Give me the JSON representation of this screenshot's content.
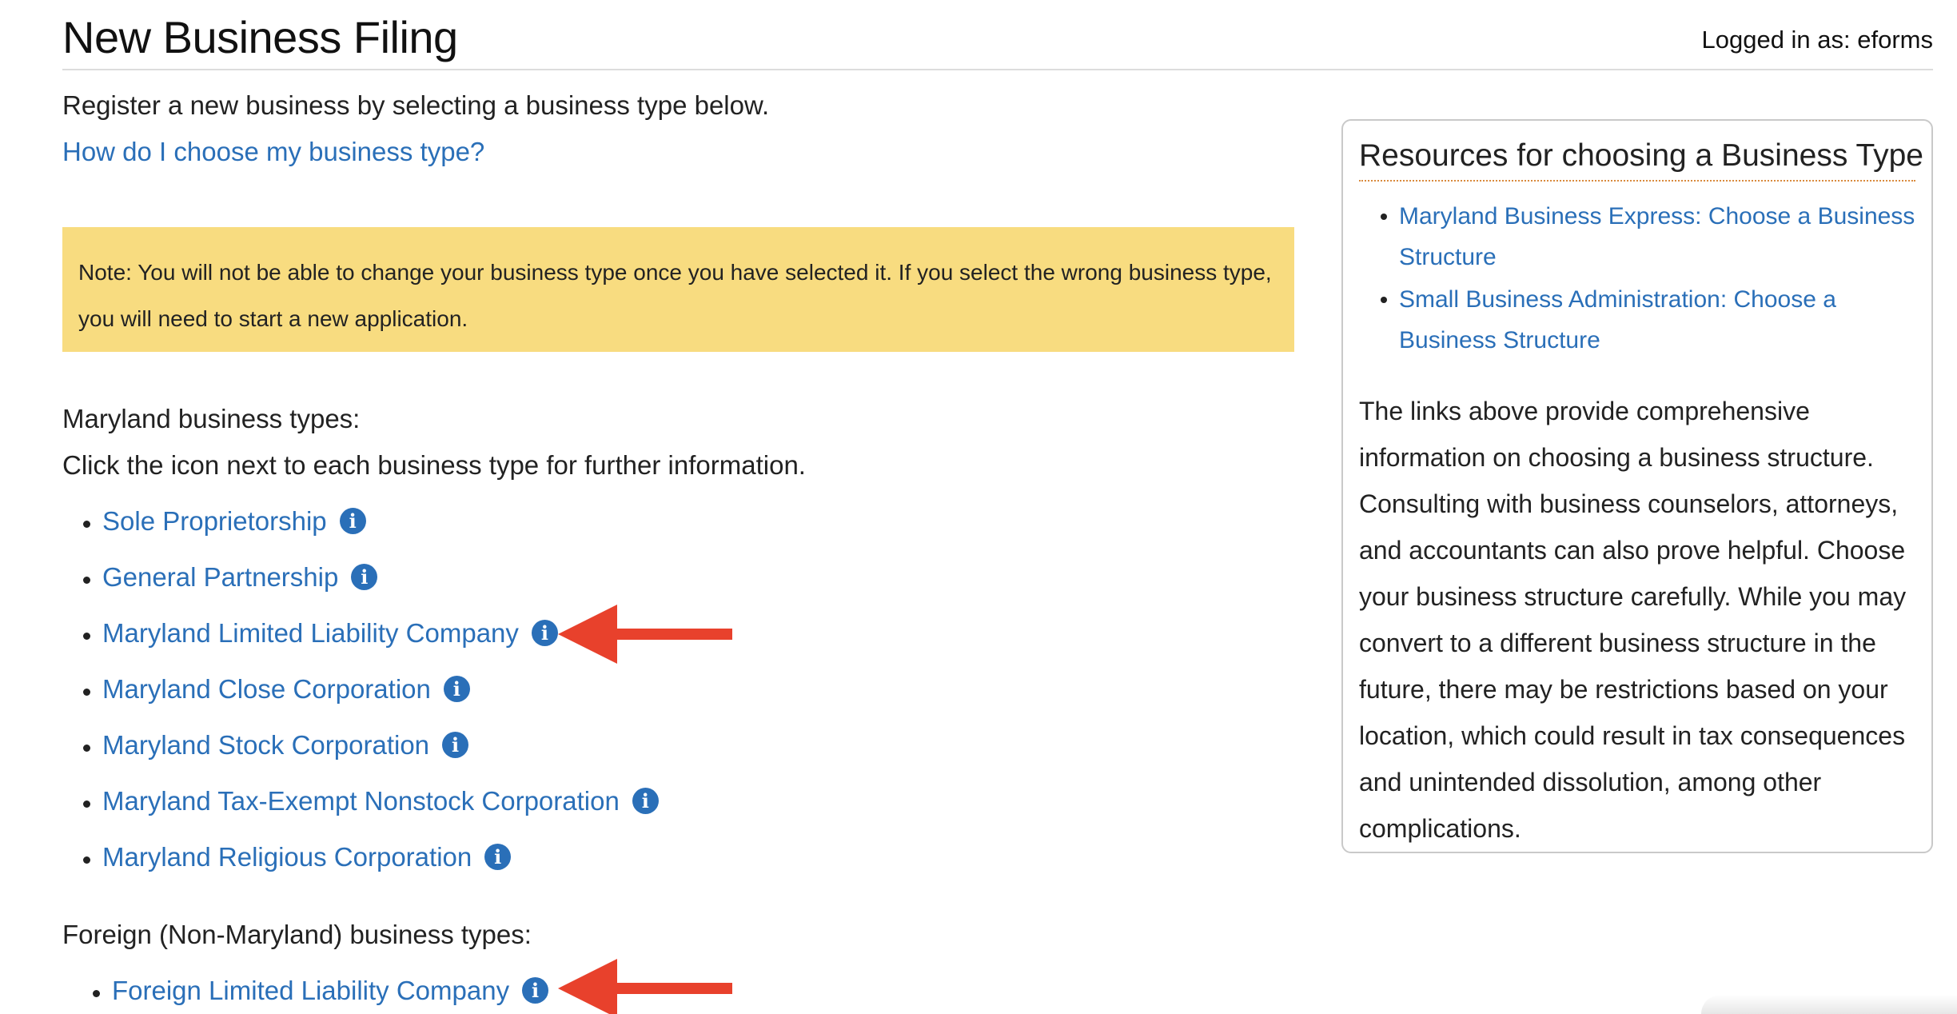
{
  "header": {
    "title": "New Business Filing",
    "logged_in": "Logged in as: eforms"
  },
  "main": {
    "intro": "Register a new business by selecting a business type below.",
    "help_link": "How do I choose my business type?",
    "note": "Note: You will not be able to change your business type once you have selected it. If you select the wrong business type, you will need to start a new application.",
    "maryland_label": "Maryland business types:",
    "maryland_instructions": "Click the icon next to each business type for further information.",
    "maryland_types": [
      {
        "label": "Sole Proprietorship",
        "icon": "info-icon"
      },
      {
        "label": "General Partnership",
        "icon": "info-icon"
      },
      {
        "label": "Maryland Limited Liability Company",
        "icon": "info-icon"
      },
      {
        "label": "Maryland Close Corporation",
        "icon": "info-icon"
      },
      {
        "label": "Maryland Stock Corporation",
        "icon": "info-icon"
      },
      {
        "label": "Maryland Tax-Exempt Nonstock Corporation",
        "icon": "info-icon"
      },
      {
        "label": "Maryland Religious Corporation",
        "icon": "info-icon"
      }
    ],
    "foreign_label": "Foreign (Non-Maryland) business types:",
    "foreign_types": [
      {
        "label": "Foreign Limited Liability Company",
        "icon": "info-icon"
      }
    ],
    "annotation_arrow_color": "#e8412c"
  },
  "sidebar": {
    "title": "Resources for choosing a Business Type",
    "links": [
      "Maryland Business Express: Choose a Business Structure",
      "Small Business Administration: Choose a Business Structure"
    ],
    "text": "The links above provide comprehensive information on choosing a business structure. Consulting with business counselors, attorneys, and accountants can also prove helpful. Choose your business structure carefully. While you may convert to a different business structure in the future, there may be restrictions based on your location, which could result in tax consequences and unintended dissolution, among other complications."
  },
  "colors": {
    "link": "#2a6fb8",
    "note_background": "#f8dc80",
    "sidebar_border": "#c9c9c9",
    "title_underline": "#d98a3d"
  }
}
